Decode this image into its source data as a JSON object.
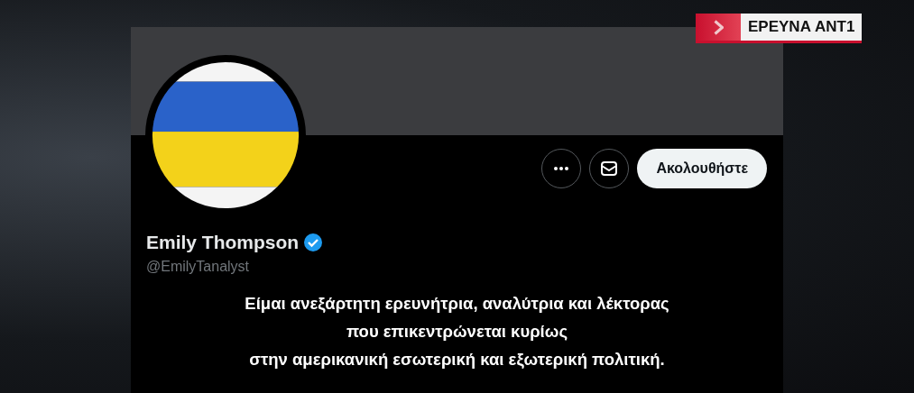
{
  "channel_badge": {
    "label": "ΕΡΕΥΝΑ ΑΝΤ1"
  },
  "profile": {
    "name": "Emily Thompson",
    "verified": true,
    "handle": "@EmilyTanalyst",
    "follow_button": "Ακολουθήστε",
    "bio": [
      "Είμαι ανεξάρτητη ερευνήτρια, αναλύτρια και λέκτορας",
      "που επικεντρώνεται κυρίως",
      "στην αμερικανική εσωτερική και εξωτερική πολιτική."
    ]
  }
}
